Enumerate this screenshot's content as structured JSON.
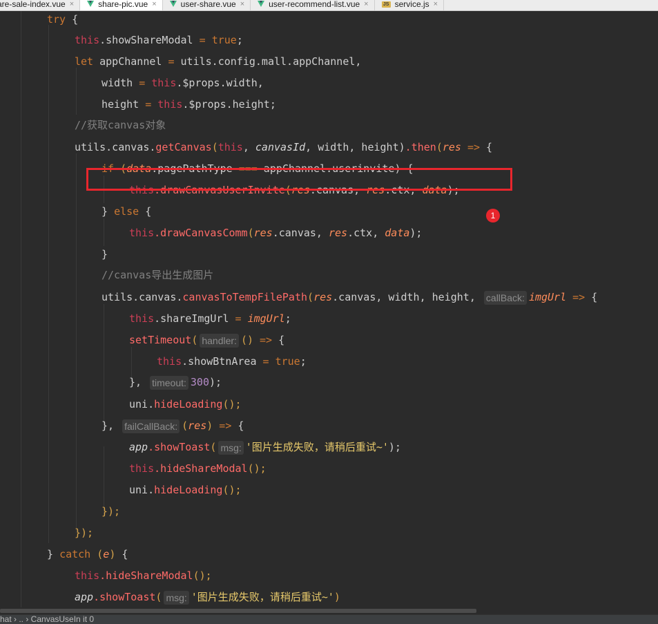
{
  "tabs": [
    {
      "label": "are-sale-index.vue",
      "close": "×",
      "icon": "vue-icon"
    },
    {
      "label": "share-pic.vue",
      "close": "×",
      "icon": "vue-icon",
      "active": true
    },
    {
      "label": "user-share.vue",
      "close": "×",
      "icon": "vue-icon"
    },
    {
      "label": "user-recommend-list.vue",
      "close": "×",
      "icon": "vue-icon"
    },
    {
      "label": "service.js",
      "close": "×",
      "icon": "js-icon",
      "icon_text": "JS"
    }
  ],
  "colors": {
    "background": "#2b2b2b",
    "keyword": "#cc7832",
    "this": "#cc3f56",
    "function": "#ff6b68",
    "string": "#e7c96b",
    "comment": "#808080",
    "number": "#b58cc8",
    "highlight_box": "#e8262d"
  },
  "code": {
    "try": "try",
    "this": "this",
    "showShareModal": ".showShareModal",
    "assign": " = ",
    "true": "true",
    "semi": ";",
    "let": "let",
    "appChannel_decl": " appChannel ",
    "eq": "=",
    "config_path": " utils.config.mall.appChannel,",
    "width_name": "width ",
    "props_width": ".$props.width,",
    "height_name": "height ",
    "props_height": ".$props.height;",
    "comment_get_canvas": "//获取canvas对象",
    "utils_canvas": "utils.canvas.",
    "getCanvas": "getCanvas",
    "open_paren": "(",
    "comma_space": ", ",
    "canvasId": "canvasId",
    "width_height_close": ", width, height)",
    "then": ".then",
    "res": "res",
    "arrow": " =>",
    "brace_open": " {",
    "if": "if",
    "data": "data",
    "pagePathType": ".pagePathType ",
    "triple_eq": "===",
    "userinvite": " appChannel.userinvite) ",
    "drawCanvasUserInvite": ".drawCanvasUserInvite",
    "dot_canvas": ".canvas, ",
    "dot_ctx": ".ctx, ",
    "close_semi": ");",
    "close_brace": "}",
    "else": "else",
    "drawCanvasComm": ".drawCanvasComm",
    "comment_export": "//canvas导出生成图片",
    "canvasToTempFilePath": "canvasToTempFilePath",
    "res_canvas_args": ".canvas, width, height, ",
    "hint_callBack": "callBack:",
    "imgUrl": "imgUrl",
    "shareImgUrl": ".shareImgUrl ",
    "setTimeout": "setTimeout",
    "hint_handler": "handler:",
    "empty_args": "()",
    "showBtnArea": ".showBtnArea ",
    "close_brace_comma": "},",
    "hint_timeout": "timeout:",
    "timeout_value": "300",
    "uni": "uni.",
    "hideLoading": "hideLoading",
    "call_semi": "();",
    "hint_failCallBack": "failCallBack:",
    "app": "app",
    "showToast": ".showToast",
    "hint_msg": "msg:",
    "toast_message": "'图片生成失败，请稍后重试~'",
    "hideShareModal": ".hideShareModal",
    "close_then": "});",
    "catch": "catch",
    "e": "e",
    "close_paren": ")"
  },
  "annotation": {
    "badge_number": "1"
  },
  "status_bar": {
    "text": "      hat › ..   ›  CanvasUseIn it 0"
  }
}
